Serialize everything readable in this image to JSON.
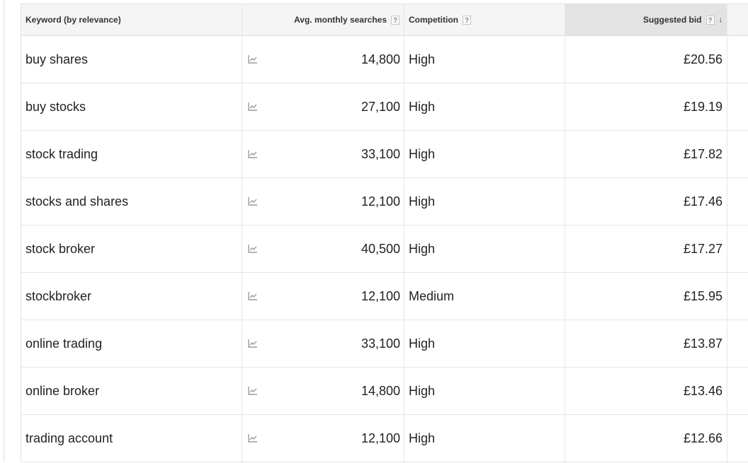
{
  "table": {
    "headers": {
      "keyword": "Keyword (by relevance)",
      "searches": "Avg. monthly searches",
      "competition": "Competition",
      "bid": "Suggested bid",
      "help_glyph": "?",
      "sort_glyph": "↓"
    },
    "rows": [
      {
        "keyword": "buy shares",
        "searches": "14,800",
        "competition": "High",
        "bid": "£20.56"
      },
      {
        "keyword": "buy stocks",
        "searches": "27,100",
        "competition": "High",
        "bid": "£19.19"
      },
      {
        "keyword": "stock trading",
        "searches": "33,100",
        "competition": "High",
        "bid": "£17.82"
      },
      {
        "keyword": "stocks and shares",
        "searches": "12,100",
        "competition": "High",
        "bid": "£17.46"
      },
      {
        "keyword": "stock broker",
        "searches": "40,500",
        "competition": "High",
        "bid": "£17.27"
      },
      {
        "keyword": "stockbroker",
        "searches": "12,100",
        "competition": "Medium",
        "bid": "£15.95"
      },
      {
        "keyword": "online trading",
        "searches": "33,100",
        "competition": "High",
        "bid": "£13.87"
      },
      {
        "keyword": "online broker",
        "searches": "14,800",
        "competition": "High",
        "bid": "£13.46"
      },
      {
        "keyword": "trading account",
        "searches": "12,100",
        "competition": "High",
        "bid": "£12.66"
      }
    ],
    "trend_icon": "trend-chart-icon"
  }
}
